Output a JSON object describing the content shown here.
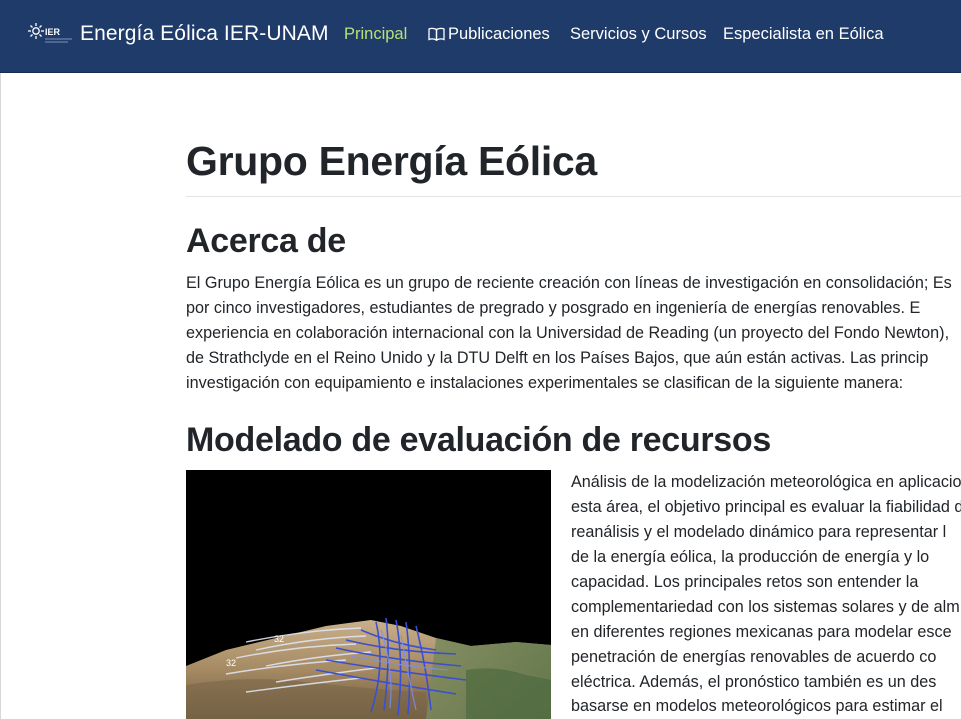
{
  "navbar": {
    "logo_text": "IER",
    "brand": "Energía Eólica IER-UNAM",
    "links": [
      {
        "label": "Principal",
        "active": true
      },
      {
        "label": "Publicaciones",
        "icon": "book-icon"
      },
      {
        "label": "Servicios y Cursos"
      },
      {
        "label": "Especialista en Eólica"
      }
    ],
    "background": "#1f3b6a",
    "active_color": "#b7e07a"
  },
  "main": {
    "title": "Grupo Energía Eólica",
    "about": {
      "heading": "Acerca de",
      "lines": [
        "El Grupo Energía Eólica es un grupo de reciente creación con líneas de investigación en consolidación; Es",
        "por cinco investigadores, estudiantes de pregrado y posgrado en ingeniería de energías renovables. E",
        "experiencia en colaboración internacional con la Universidad de Reading (un proyecto del Fondo Newton),",
        "de Strathclyde en el Reino Unido y la DTU Delft en los Países Bajos, que aún están activas. Las princip",
        "investigación con equipamiento e instalaciones experimentales se clasifican de la siguiente manera:"
      ]
    },
    "resources": {
      "heading": "Modelado de evaluación de recursos",
      "lines": [
        "Análisis de la modelización meteorológica en aplicacio",
        "esta área, el objetivo principal es evaluar la fiabilidad d",
        "reanálisis y el modelado dinámico para representar l",
        "de la energía eólica, la producción de energía y lo",
        "capacidad. Los principales retos son entender la",
        "complementariedad con los sistemas solares y de alm",
        "en diferentes regiones mexicanas para modelar esce",
        "penetración de energías renovables de acuerdo co",
        "eléctrica. Además, el pronóstico también es un des",
        "basarse en modelos meteorológicos para estimar el"
      ],
      "figure_labels": [
        "32",
        "32"
      ]
    }
  }
}
